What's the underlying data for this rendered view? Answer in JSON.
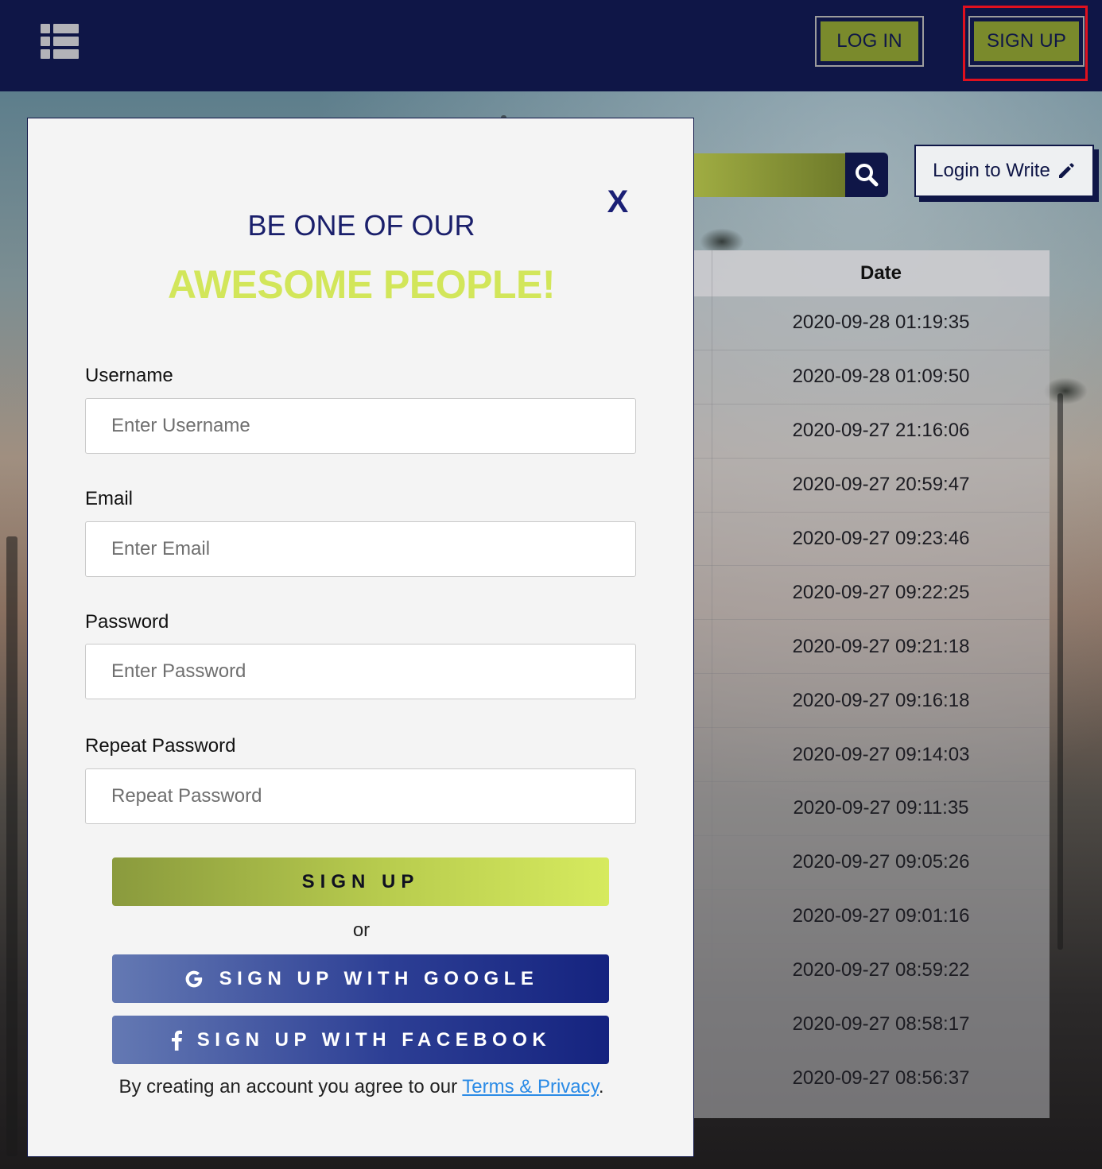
{
  "header": {
    "login_label": "LOG IN",
    "signup_label": "SIGN UP",
    "menu_icon": "list-icon"
  },
  "toolbar": {
    "search_icon": "search-icon",
    "write_label": "Login to Write",
    "write_icon": "pencil-icon"
  },
  "table": {
    "date_header": "Date",
    "dates": [
      "2020-09-28 01:19:35",
      "2020-09-28 01:09:50",
      "2020-09-27 21:16:06",
      "2020-09-27 20:59:47",
      "2020-09-27 09:23:46",
      "2020-09-27 09:22:25",
      "2020-09-27 09:21:18",
      "2020-09-27 09:16:18",
      "2020-09-27 09:14:03",
      "2020-09-27 09:11:35",
      "2020-09-27 09:05:26",
      "2020-09-27 09:01:16",
      "2020-09-27 08:59:22",
      "2020-09-27 08:58:17",
      "2020-09-27 08:56:37"
    ]
  },
  "modal": {
    "close_label": "X",
    "title_line1": "BE ONE OF OUR",
    "title_line2": "AWESOME PEOPLE!",
    "fields": [
      {
        "label": "Username",
        "placeholder": "Enter Username",
        "value": ""
      },
      {
        "label": "Email",
        "placeholder": "Enter Email",
        "value": ""
      },
      {
        "label": "Password",
        "placeholder": "Enter Password",
        "value": ""
      },
      {
        "label": "Repeat Password",
        "placeholder": "Repeat Password",
        "value": ""
      }
    ],
    "signup_button": "SIGN UP",
    "or_text": "or",
    "google_button": "SIGN UP WITH GOOGLE",
    "facebook_button": "SIGN UP WITH FACEBOOK",
    "agree_text": "By creating an account you agree to our ",
    "terms_link": "Terms & Privacy",
    "agree_end": "."
  },
  "colors": {
    "header_bg": "#0f1647",
    "accent_olive": "#7a8a2c",
    "title_green": "#d2e65a",
    "title_navy": "#1a1f6b",
    "highlight_red": "#e0101e",
    "link_blue": "#2b8be6"
  }
}
